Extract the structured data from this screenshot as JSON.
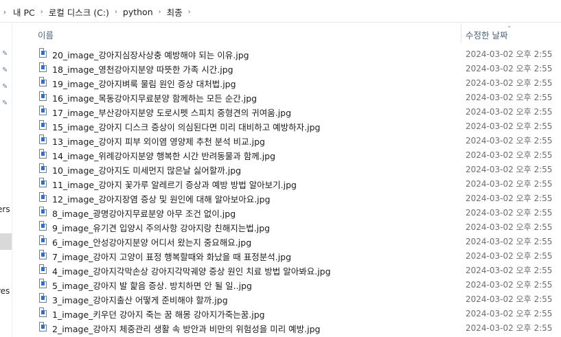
{
  "breadcrumb": {
    "items": [
      "내 PC",
      "로컬 디스크 (C:)",
      "python",
      "최종"
    ]
  },
  "nav": {
    "trunc1": "ers",
    "trunc2": "res"
  },
  "header": {
    "name_label": "이름",
    "date_label": "수정한 날짜"
  },
  "icon_colors": {
    "file_blue": "#2f6fc4",
    "pin": "#5e7da8"
  },
  "files": [
    {
      "name": "20_image_강아지심장사상충 예방해야 되는 이유.jpg",
      "date": "2024-03-02 오후 2:55"
    },
    {
      "name": "18_image_영천강아지분양 따뜻한 가족 시간.jpg",
      "date": "2024-03-02 오후 2:55"
    },
    {
      "name": "19_image_강아지벼룩 물림 원인 증상 대처법.jpg",
      "date": "2024-03-02 오후 2:55"
    },
    {
      "name": "16_image_목동강아지무료분양 함께하는 모든 순간.jpg",
      "date": "2024-03-02 오후 2:55"
    },
    {
      "name": "17_image_부산강아지분양 도로시펫 스피치 중형견의 귀여움.jpg",
      "date": "2024-03-02 오후 2:55"
    },
    {
      "name": "15_image_강아지 디스크 증상이 의심된다면 미리 대비하고 예방하자.jpg",
      "date": "2024-03-02 오후 2:55"
    },
    {
      "name": "13_image_강아지 피부 외이염 영양제 추천 분석 비교.jpg",
      "date": "2024-03-02 오후 2:55"
    },
    {
      "name": "14_image_위례강아지분양 행복한 시간 반려동물과 함께.jpg",
      "date": "2024-03-02 오후 2:55"
    },
    {
      "name": "10_image_강아지도 미세먼지 많은날 싫어할까.jpg",
      "date": "2024-03-02 오후 2:55"
    },
    {
      "name": "11_image_강아지 꽃가루 알레르기 증상과 예방 방법 알아보기.jpg",
      "date": "2024-03-02 오후 2:55"
    },
    {
      "name": "12_image_강아지장염 증상 및 원인에 대해 알아보아요.jpg",
      "date": "2024-03-02 오후 2:55"
    },
    {
      "name": "8_image_광명강아지무료분양 아무 조건 없이.jpg",
      "date": "2024-03-02 오후 2:55"
    },
    {
      "name": "9_image_유기견 입양시 주의사항 강아지랑 친해지는법.jpg",
      "date": "2024-03-02 오후 2:55"
    },
    {
      "name": "6_image_안성강아지분양 어디서 왔는지 중요해요.jpg",
      "date": "2024-03-02 오후 2:55"
    },
    {
      "name": "7_image_강아지 고양이 표정 행복할때와 화났을 때 표정분석.jpg",
      "date": "2024-03-02 오후 2:55"
    },
    {
      "name": "4_image_강아지각막손상 강아지각막궤양 증상 원인 치료 방법 알아봐요.jpg",
      "date": "2024-03-02 오후 2:55"
    },
    {
      "name": "5_image_강아지 발 핥음 증상. 방치하면 안 될 일..jpg",
      "date": "2024-03-02 오후 2:55"
    },
    {
      "name": "3_image_강아지출산 어떻게 준비해야 할까.jpg",
      "date": "2024-03-02 오후 2:55"
    },
    {
      "name": "1_image_키우던 강아지 죽는 꿈 해몽 강아지가죽는꿈.jpg",
      "date": "2024-03-02 오후 2:55"
    },
    {
      "name": "2_image_강아지 체중관리 생활 속 방안과 비만의 위험성을 미리 예방.jpg",
      "date": "2024-03-02 오후 2:55"
    }
  ]
}
